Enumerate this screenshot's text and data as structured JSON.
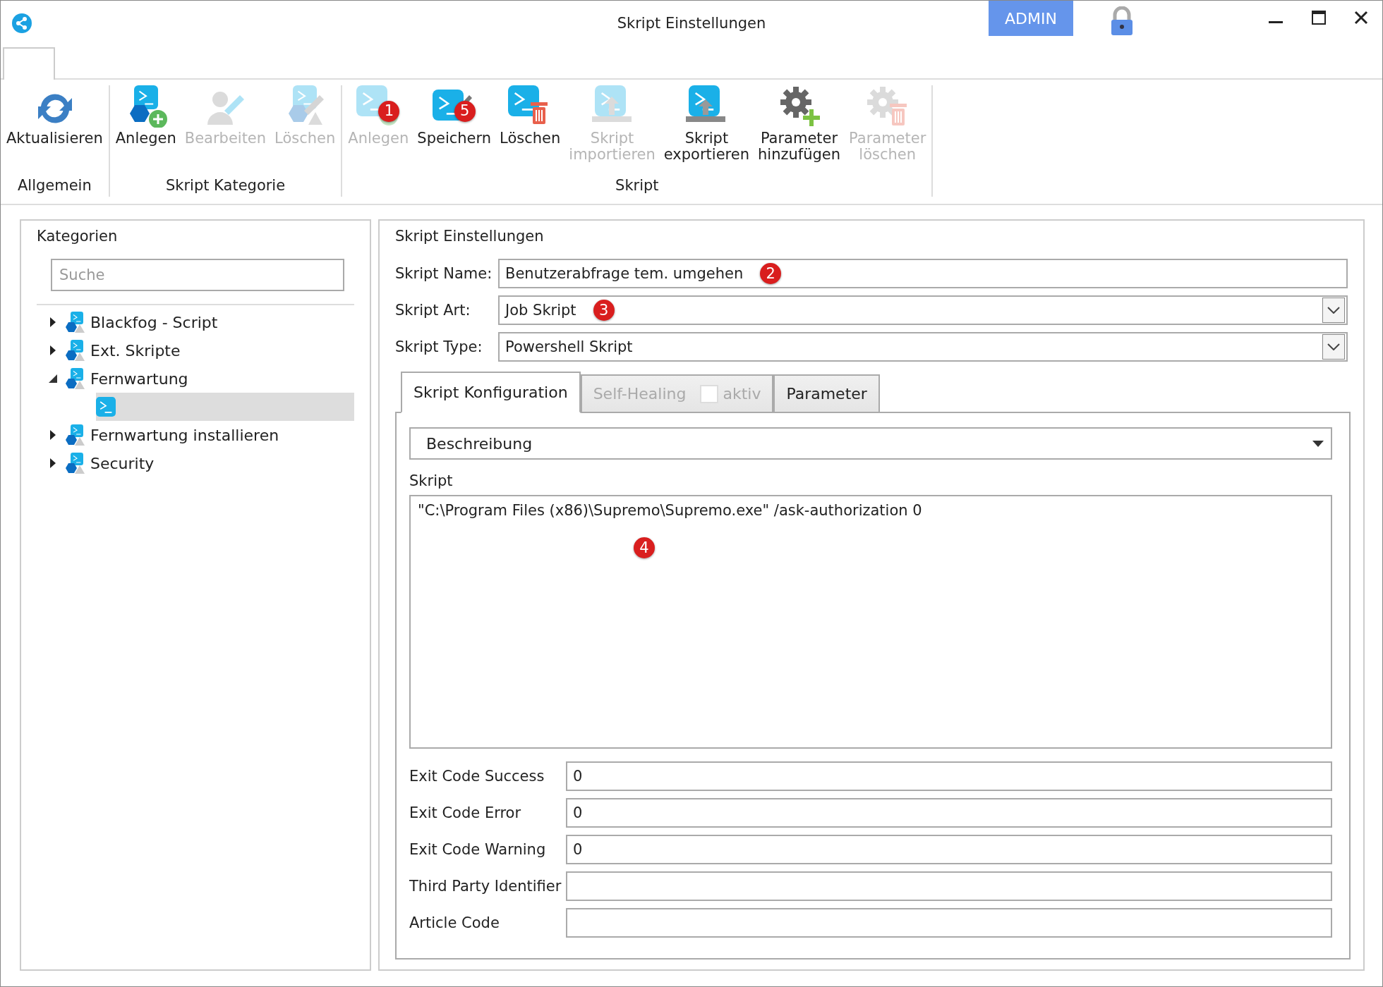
{
  "window": {
    "title": "Skript Einstellungen",
    "user_badge": "ADMIN"
  },
  "ribbon": {
    "groups": [
      {
        "label": "Allgemein",
        "buttons": [
          {
            "label": "Aktualisieren",
            "kind": "refresh",
            "disabled": false
          }
        ]
      },
      {
        "label": "Skript Kategorie",
        "buttons": [
          {
            "label": "Anlegen",
            "kind": "cat-add",
            "disabled": false
          },
          {
            "label": "Bearbeiten",
            "kind": "cat-edit",
            "disabled": true
          },
          {
            "label": "Löschen",
            "kind": "cat-delete",
            "disabled": true
          }
        ]
      },
      {
        "label": "Skript",
        "buttons": [
          {
            "label": "Anlegen",
            "kind": "script-add",
            "disabled": true,
            "marker": "1"
          },
          {
            "label": "Speichern",
            "kind": "script-save",
            "disabled": false,
            "marker": "5"
          },
          {
            "label": "Löschen",
            "kind": "script-delete",
            "disabled": false
          },
          {
            "label": "Skript\nimportieren",
            "kind": "import",
            "disabled": true
          },
          {
            "label": "Skript\nexportieren",
            "kind": "export",
            "disabled": false
          },
          {
            "label": "Parameter\nhinzufügen",
            "kind": "param-add",
            "disabled": false
          },
          {
            "label": "Parameter\nlöschen",
            "kind": "param-delete",
            "disabled": true
          }
        ]
      }
    ]
  },
  "categories": {
    "title": "Kategorien",
    "search": {
      "placeholder": "Suche"
    },
    "tree": [
      {
        "label": "Blackfog - Script",
        "expanded": false,
        "selected": false
      },
      {
        "label": "Ext. Skripte",
        "expanded": false,
        "selected": false
      },
      {
        "label": "Fernwartung",
        "expanded": true,
        "selected": false,
        "children": [
          {
            "kind": "script",
            "selected": true
          }
        ]
      },
      {
        "label": "Fernwartung installieren",
        "expanded": false,
        "selected": false
      },
      {
        "label": "Security",
        "expanded": false,
        "selected": false
      }
    ]
  },
  "settings": {
    "title": "Skript Einstellungen",
    "fields": [
      {
        "label": "Skript Name:",
        "value": "Benutzerabfrage tem. umgehen",
        "kind": "text",
        "marker": "2"
      },
      {
        "label": "Skript Art:",
        "value": "Job Skript",
        "kind": "select",
        "marker": "3"
      },
      {
        "label": "Skript Type:",
        "value": "Powershell Skript",
        "kind": "select"
      }
    ],
    "tabs": [
      {
        "label": "Skript Konfiguration",
        "selected": true,
        "disabled": false
      },
      {
        "label": "Self-Healing",
        "selected": false,
        "disabled": true,
        "checkbox": {
          "label": "aktiv",
          "checked": false
        }
      },
      {
        "label": "Parameter",
        "selected": false,
        "disabled": false
      }
    ],
    "config": {
      "section": "Beschreibung",
      "script_label": "Skript",
      "script": "\"C:\\Program Files (x86)\\Supremo\\Supremo.exe\" /ask-authorization 0",
      "script_marker": "4",
      "codes": [
        {
          "label": "Exit Code Success",
          "value": "0"
        },
        {
          "label": "Exit Code Error",
          "value": "0"
        },
        {
          "label": "Exit Code Warning",
          "value": "0"
        },
        {
          "label": "Third Party Identifier"
        },
        {
          "label": "Article Code"
        }
      ]
    }
  }
}
